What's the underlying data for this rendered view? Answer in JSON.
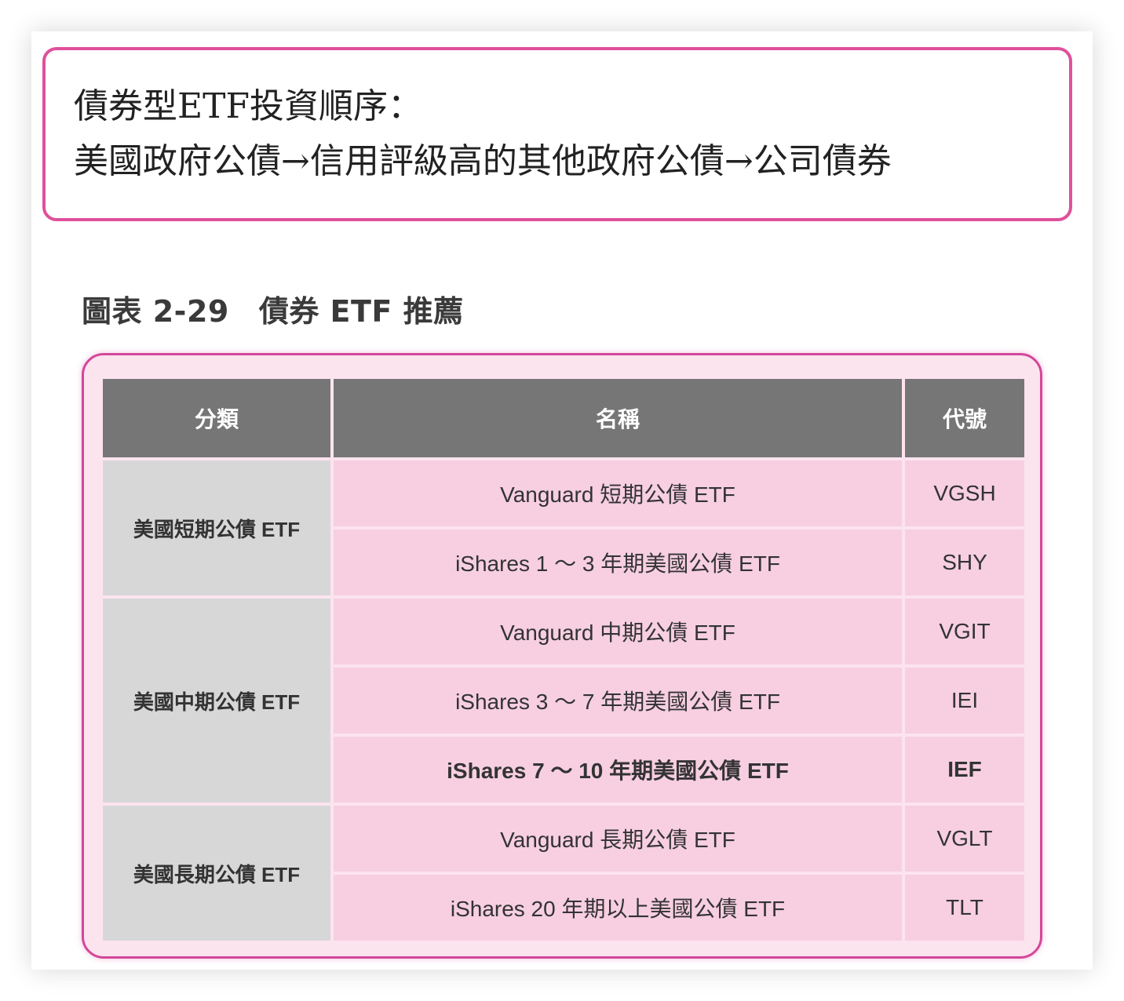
{
  "callout": {
    "line1": "債券型ETF投資順序：",
    "line2": "美國政府公債→信用評級高的其他政府公債→公司債券"
  },
  "figure": {
    "number": "圖表 2-29",
    "title": "債券 ETF 推薦"
  },
  "table": {
    "headers": [
      "分類",
      "名稱",
      "代號"
    ],
    "groups": [
      {
        "category": "美國短期公債 ETF",
        "rows": [
          {
            "name": "Vanguard 短期公債 ETF",
            "code": "VGSH"
          },
          {
            "name": "iShares 1 ～ 3 年期美國公債 ETF",
            "code": "SHY"
          }
        ]
      },
      {
        "category": "美國中期公債 ETF",
        "rows": [
          {
            "name": "Vanguard 中期公債 ETF",
            "code": "VGIT"
          },
          {
            "name": "iShares 3 ～ 7 年期美國公債 ETF",
            "code": "IEI"
          },
          {
            "name": "iShares 7 ～ 10 年期美國公債 ETF",
            "code": "IEF"
          }
        ]
      },
      {
        "category": "美國長期公債 ETF",
        "rows": [
          {
            "name": "Vanguard 長期公債 ETF",
            "code": "VGLT"
          },
          {
            "name": "iShares 20 年期以上美國公債 ETF",
            "code": "TLT"
          }
        ]
      }
    ]
  }
}
